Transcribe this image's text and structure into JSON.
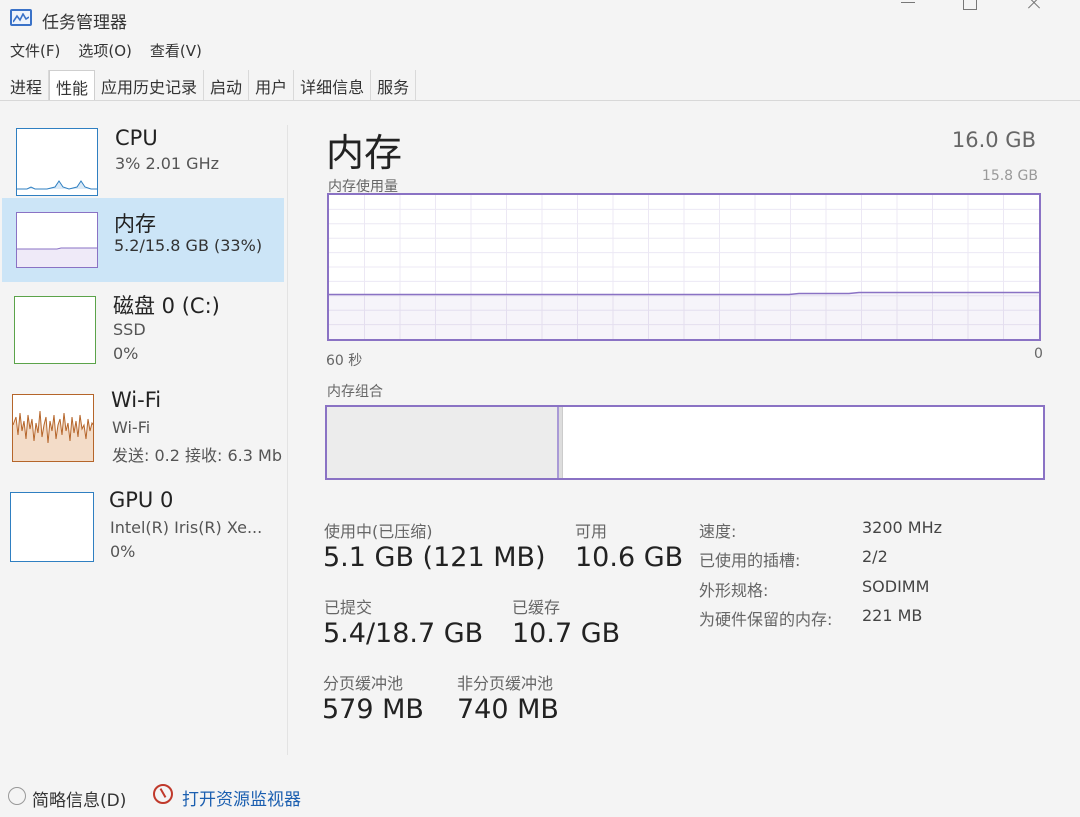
{
  "window": {
    "title": "任务管理器"
  },
  "menu": [
    "文件(F)",
    "选项(O)",
    "查看(V)"
  ],
  "tabs": [
    "进程",
    "性能",
    "应用历史记录",
    "启动",
    "用户",
    "详细信息",
    "服务"
  ],
  "sidebar": {
    "items": [
      {
        "title": "CPU",
        "sub1": "3% 2.01 GHz",
        "sub2": "",
        "sub3": "",
        "color": "#2f7fc1"
      },
      {
        "title": "内存",
        "sub1": "5.2/15.8 GB (33%)",
        "sub2": "",
        "sub3": "",
        "color": "#8a72c4"
      },
      {
        "title": "磁盘 0 (C:)",
        "sub1": "SSD",
        "sub2": "0%",
        "sub3": "",
        "color": "#5ba34a"
      },
      {
        "title": "Wi-Fi",
        "sub1": "Wi-Fi",
        "sub2": "发送: 0.2 接收: 6.3 Mb",
        "sub3": "",
        "color": "#b5652a"
      },
      {
        "title": "GPU 0",
        "sub1": "Intel(R) Iris(R) Xe...",
        "sub2": "0%",
        "sub3": "",
        "color": "#2f7fc1"
      }
    ]
  },
  "main": {
    "title": "内存",
    "total": "16.0 GB",
    "usage_label": "内存使用量",
    "usage_max": "15.8 GB",
    "axis_left": "60 秒",
    "axis_right": "0",
    "composition_label": "内存组合",
    "usage_fraction": 0.33,
    "stats": {
      "in_use_label": "使用中(已压缩)",
      "in_use_value": "5.1 GB (121 MB)",
      "available_label": "可用",
      "available_value": "10.6 GB",
      "committed_label": "已提交",
      "committed_value": "5.4/18.7 GB",
      "cached_label": "已缓存",
      "cached_value": "10.7 GB",
      "paged_label": "分页缓冲池",
      "paged_value": "579 MB",
      "nonpaged_label": "非分页缓冲池",
      "nonpaged_value": "740 MB"
    },
    "details": [
      {
        "key": "速度:",
        "value": "3200 MHz"
      },
      {
        "key": "已使用的插槽:",
        "value": "2/2"
      },
      {
        "key": "外形规格:",
        "value": "SODIMM"
      },
      {
        "key": "为硬件保留的内存:",
        "value": "221 MB"
      }
    ]
  },
  "footer": {
    "collapse": "简略信息(D)",
    "monitor_link": "打开资源监视器"
  }
}
